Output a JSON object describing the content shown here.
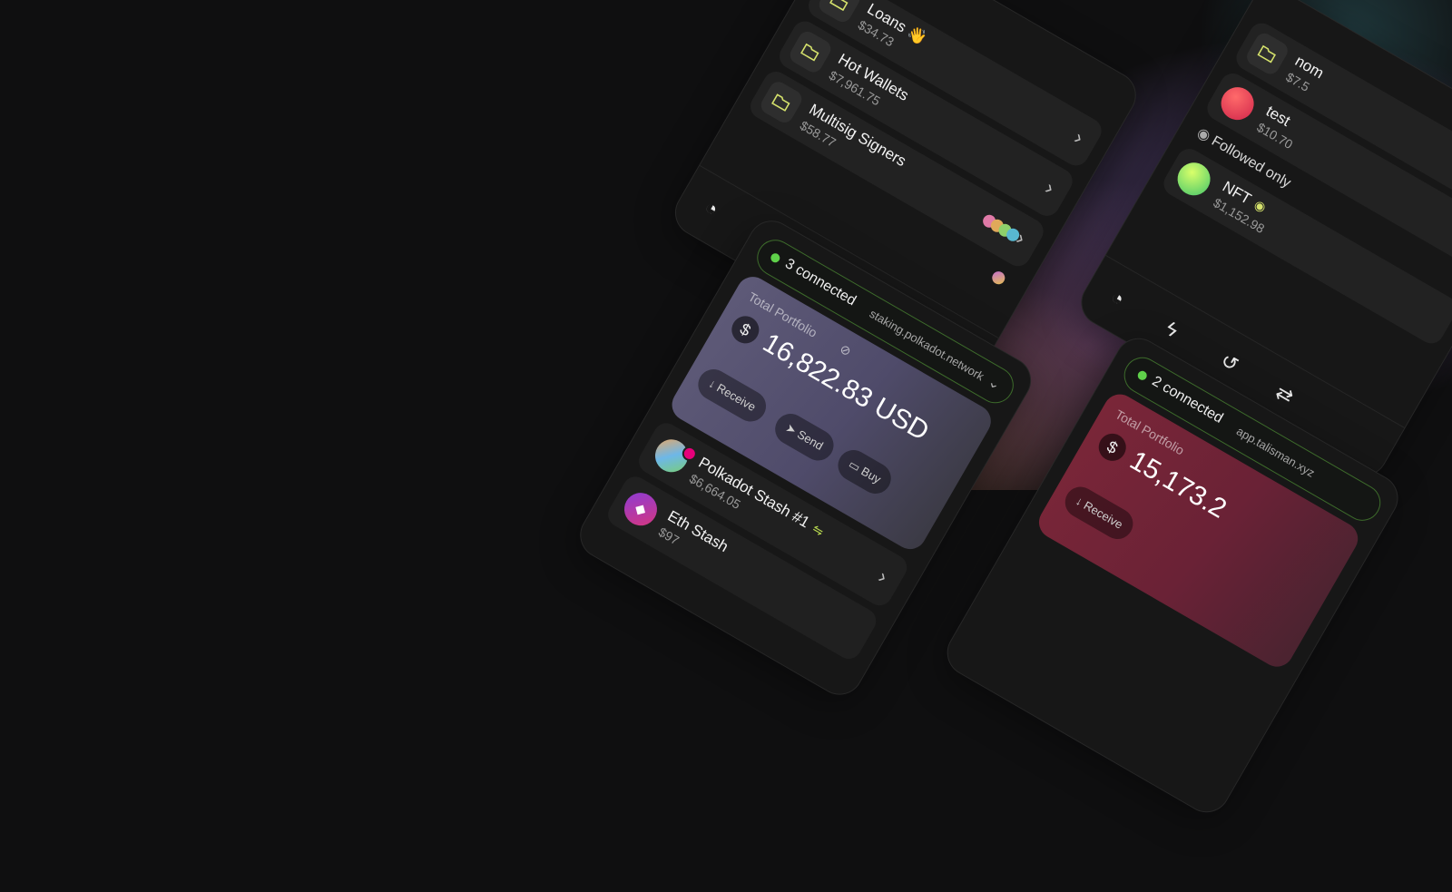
{
  "windows": {
    "top": {
      "items": [
        {
          "title": "Loans 👋",
          "value": "$34.73"
        },
        {
          "title": "Hot Wallets",
          "value": "$7,961.75"
        },
        {
          "title": "Multisig Signers",
          "value": "$58.77"
        }
      ],
      "nav": [
        "pie-chart-icon",
        "lightning-icon",
        "history-icon",
        "swap-arrows-icon",
        "more-icon"
      ],
      "nav_glyphs": [
        "◔",
        "ϟ",
        "↺",
        "⇄",
        "⋯"
      ]
    },
    "middle": {
      "connected_label": "3 connected",
      "site": "staking.polkadot.network",
      "portfolio_label": "Total Portfolio",
      "portfolio_value": "16,822.83 USD",
      "buttons": {
        "receive": "Receive",
        "send": "Send",
        "buy": "Buy"
      },
      "accounts": [
        {
          "name": "Polkadot Stash #1",
          "value": "$6,664.05"
        },
        {
          "name": "Eth Stash",
          "value": "$97"
        }
      ]
    },
    "right_top": {
      "items": [
        {
          "title": "nom",
          "value": "$7.5"
        },
        {
          "title": "test",
          "value": "$10.70"
        }
      ],
      "followed_label": "Followed only",
      "nft": {
        "title": "NFT",
        "value": "$1,152.98"
      },
      "nav": [
        "pie-chart-icon",
        "lightning-icon",
        "history-icon",
        "swap-arrows-icon"
      ]
    },
    "right_bottom": {
      "connected_label": "2 connected",
      "site": "app.talisman.xyz",
      "portfolio_label": "Total Portfolio",
      "portfolio_value": "15,173.2",
      "buttons": {
        "receive": "Receive"
      }
    }
  },
  "colors": {
    "background": "#0f0f10",
    "card": "#171717",
    "item": "#222222",
    "connected_green": "#5fd14a",
    "folder_yellow": "#d5e26c"
  }
}
